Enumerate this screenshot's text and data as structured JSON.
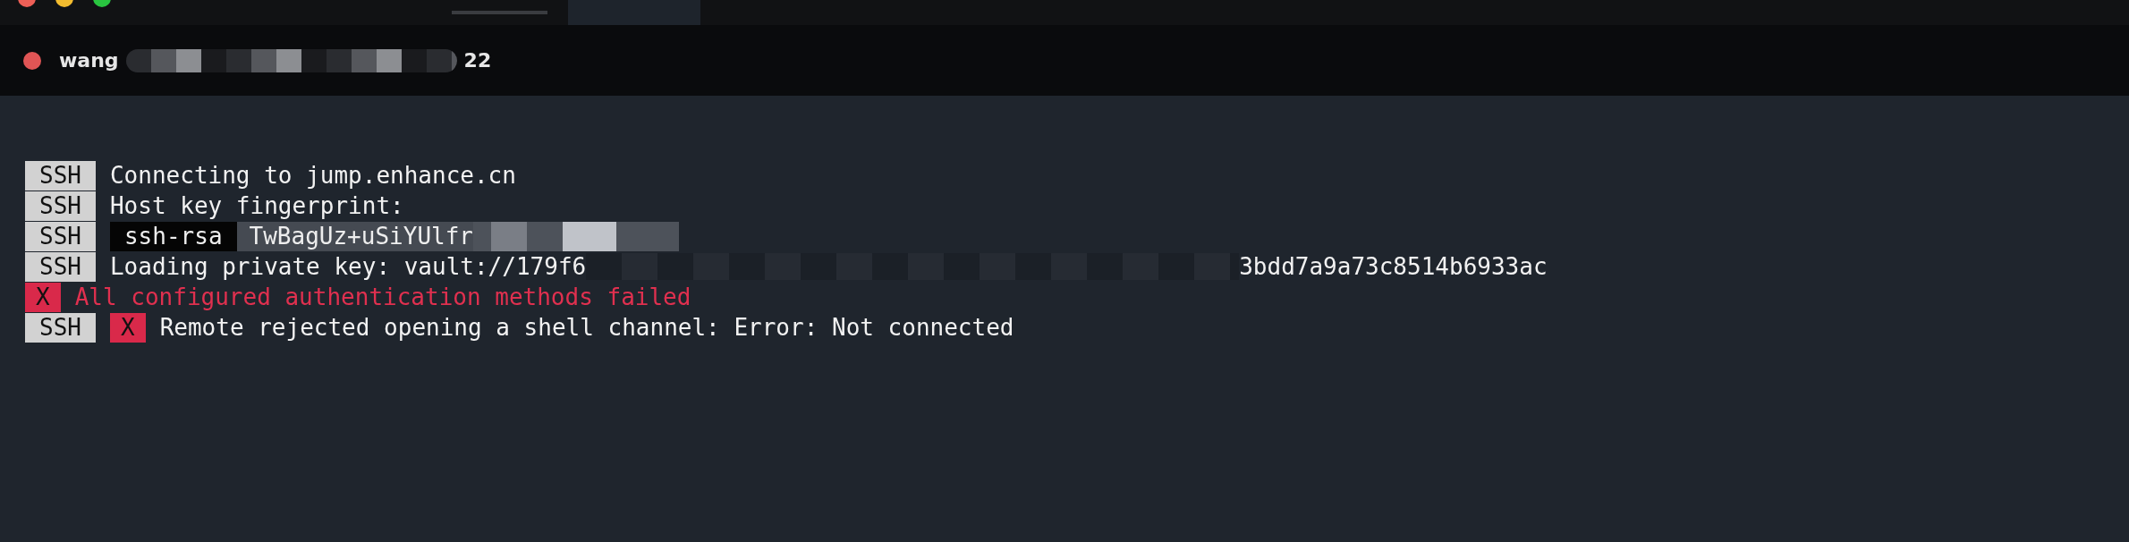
{
  "host": {
    "name_start": "wang",
    "name_end": "22"
  },
  "lines": [
    {
      "kind": "ssh",
      "tag": "SSH",
      "text": "Connecting to jump.enhance.cn"
    },
    {
      "kind": "ssh",
      "tag": "SSH",
      "text": "Host key fingerprint:"
    },
    {
      "kind": "fingerprint",
      "tag": "SSH",
      "key_type": "ssh-rsa",
      "text": "TwBagUz+uSiYUlfr"
    },
    {
      "kind": "ssh",
      "tag": "SSH",
      "text": "Loading private key: vault://179f6",
      "text_end": "3bdd7a9a73c8514b6933ac"
    },
    {
      "kind": "error",
      "badge": "X",
      "text": "All configured authentication methods failed"
    },
    {
      "kind": "ssh_error",
      "tag": "SSH",
      "badge": "X",
      "text": "Remote rejected opening a shell channel: Error: Not connected"
    }
  ]
}
